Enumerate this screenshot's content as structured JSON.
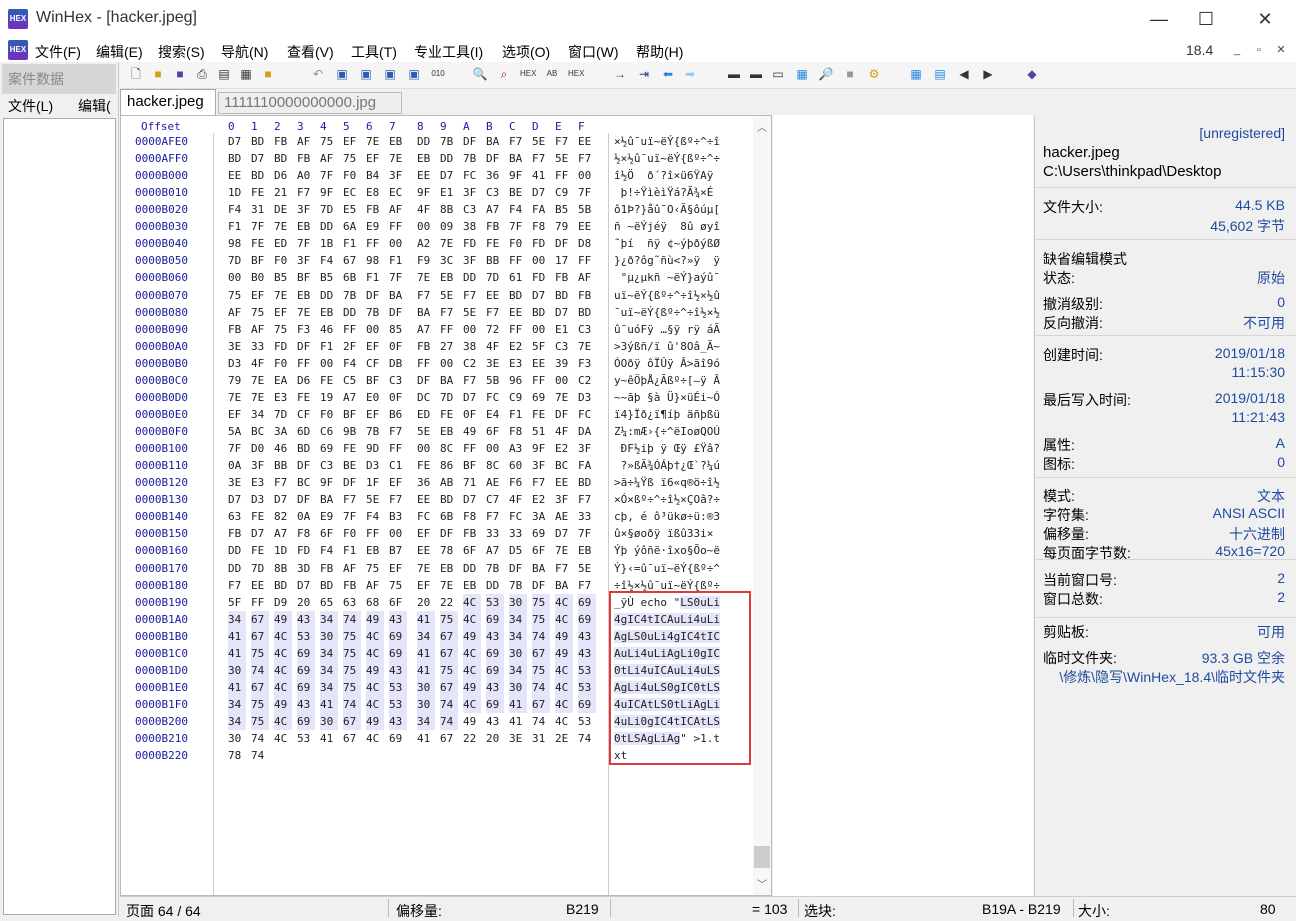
{
  "window": {
    "title": "WinHex - [hacker.jpeg]",
    "logo": "HEX",
    "controls": [
      "—",
      "☐",
      "✕"
    ]
  },
  "menu": {
    "items": [
      "文件(F)",
      "编辑(E)",
      "搜索(S)",
      "导航(N)",
      "查看(V)",
      "工具(T)",
      "专业工具(I)",
      "选项(O)",
      "窗口(W)",
      "帮助(H)"
    ],
    "version": "18.4",
    "mdi_controls": [
      "_",
      "▫",
      "✕"
    ]
  },
  "case_panel": {
    "title": "案件数据",
    "menu": [
      "文件(L)",
      "编辑("
    ]
  },
  "tabs": {
    "active": "hacker.jpeg",
    "other": "1111110000000000.jpg"
  },
  "hex_header": {
    "offset_label": "Offset",
    "columns": [
      "0",
      "1",
      "2",
      "3",
      "4",
      "5",
      "6",
      "7",
      "8",
      "9",
      "A",
      "B",
      "C",
      "D",
      "E",
      "F"
    ]
  },
  "rows": [
    {
      "off": "0000AFE0",
      "hex": [
        "D7",
        "BD",
        "FB",
        "AF",
        "75",
        "EF",
        "7E",
        "EB",
        "DD",
        "7B",
        "DF",
        "BA",
        "F7",
        "5E",
        "F7",
        "EE"
      ],
      "txt": "×½û¯uï~ëÝ{ßº÷^÷î"
    },
    {
      "off": "0000AFF0",
      "hex": [
        "BD",
        "D7",
        "BD",
        "FB",
        "AF",
        "75",
        "EF",
        "7E",
        "EB",
        "DD",
        "7B",
        "DF",
        "BA",
        "F7",
        "5E",
        "F7"
      ],
      "txt": "½×½û¯uï~ëÝ{ßº÷^÷"
    },
    {
      "off": "0000B000",
      "hex": [
        "EE",
        "BD",
        "D6",
        "A0",
        "7F",
        "F0",
        "B4",
        "3F",
        "EE",
        "D7",
        "FC",
        "36",
        "9F",
        "41",
        "FF",
        "00"
      ],
      "txt": "î½Ö  ð´?î×ü6ŸAÿ "
    },
    {
      "off": "0000B010",
      "hex": [
        "1D",
        "FE",
        "21",
        "F7",
        "9F",
        "EC",
        "E8",
        "EC",
        "9F",
        "E1",
        "3F",
        "C3",
        "BE",
        "D7",
        "C9",
        "7F"
      ],
      "txt": " þ!÷ŸìèìŸá?Ã¾×É "
    },
    {
      "off": "0000B020",
      "hex": [
        "F4",
        "31",
        "DE",
        "3F",
        "7D",
        "E5",
        "FB",
        "AF",
        "4F",
        "8B",
        "C3",
        "A7",
        "F4",
        "FA",
        "B5",
        "5B"
      ],
      "txt": "ô1Þ?}åû¯O‹Ã§ôúµ["
    },
    {
      "off": "0000B030",
      "hex": [
        "F1",
        "7F",
        "7E",
        "EB",
        "DD",
        "6A",
        "E9",
        "FF",
        "00",
        "09",
        "38",
        "FB",
        "7F",
        "F8",
        "79",
        "EE"
      ],
      "txt": "ñ ~ëÝjéÿ  8û øyî"
    },
    {
      "off": "0000B040",
      "hex": [
        "98",
        "FE",
        "ED",
        "7F",
        "1B",
        "F1",
        "FF",
        "00",
        "A2",
        "7E",
        "FD",
        "FE",
        "F0",
        "FD",
        "DF",
        "D8"
      ],
      "txt": "˜þí  ñÿ ¢~ýþðýßØ"
    },
    {
      "off": "0000B050",
      "hex": [
        "7D",
        "BF",
        "F0",
        "3F",
        "F4",
        "67",
        "98",
        "F1",
        "F9",
        "3C",
        "3F",
        "BB",
        "FF",
        "00",
        "17",
        "FF"
      ],
      "txt": "}¿ð?ôg˜ñù<?»ÿ  ÿ"
    },
    {
      "off": "0000B060",
      "hex": [
        "00",
        "B0",
        "B5",
        "BF",
        "B5",
        "6B",
        "F1",
        "7F",
        "7E",
        "EB",
        "DD",
        "7D",
        "61",
        "FD",
        "FB",
        "AF"
      ],
      "txt": " °µ¿µkñ ~ëÝ}aýû¯"
    },
    {
      "off": "0000B070",
      "hex": [
        "75",
        "EF",
        "7E",
        "EB",
        "DD",
        "7B",
        "DF",
        "BA",
        "F7",
        "5E",
        "F7",
        "EE",
        "BD",
        "D7",
        "BD",
        "FB"
      ],
      "txt": "uï~ëÝ{ßº÷^÷î½×½û"
    },
    {
      "off": "0000B080",
      "hex": [
        "AF",
        "75",
        "EF",
        "7E",
        "EB",
        "DD",
        "7B",
        "DF",
        "BA",
        "F7",
        "5E",
        "F7",
        "EE",
        "BD",
        "D7",
        "BD"
      ],
      "txt": "¯uï~ëÝ{ßº÷^÷î½×½"
    },
    {
      "off": "0000B090",
      "hex": [
        "FB",
        "AF",
        "75",
        "F3",
        "46",
        "FF",
        "00",
        "85",
        "A7",
        "FF",
        "00",
        "72",
        "FF",
        "00",
        "E1",
        "C3"
      ],
      "txt": "û¯uóFÿ …§ÿ rÿ áÃ"
    },
    {
      "off": "0000B0A0",
      "hex": [
        "3E",
        "33",
        "FD",
        "DF",
        "F1",
        "2F",
        "EF",
        "0F",
        "FB",
        "27",
        "38",
        "4F",
        "E2",
        "5F",
        "C3",
        "7E"
      ],
      "txt": ">3ýßñ/ï û'8Oâ_Ã~"
    },
    {
      "off": "0000B0B0",
      "hex": [
        "D3",
        "4F",
        "F0",
        "FF",
        "00",
        "F4",
        "CF",
        "DB",
        "FF",
        "00",
        "C2",
        "3E",
        "E3",
        "EE",
        "39",
        "F3"
      ],
      "txt": "ÓOðÿ ôÏÛÿ Â>ãî9ó"
    },
    {
      "off": "0000B0C0",
      "hex": [
        "79",
        "7E",
        "EA",
        "D6",
        "FE",
        "C5",
        "BF",
        "C3",
        "DF",
        "BA",
        "F7",
        "5B",
        "96",
        "FF",
        "00",
        "C2"
      ],
      "txt": "y~êÖþÅ¿Ãßº÷[–ÿ Â"
    },
    {
      "off": "0000B0D0",
      "hex": [
        "7E",
        "7E",
        "E3",
        "FE",
        "19",
        "A7",
        "E0",
        "0F",
        "DC",
        "7D",
        "D7",
        "FC",
        "C9",
        "69",
        "7E",
        "D3"
      ],
      "txt": "~~ãþ §à Ü}×üÉi~Ó"
    },
    {
      "off": "0000B0E0",
      "hex": [
        "EF",
        "34",
        "7D",
        "CF",
        "F0",
        "BF",
        "EF",
        "B6",
        "ED",
        "FE",
        "0F",
        "E4",
        "F1",
        "FE",
        "DF",
        "FC"
      ],
      "txt": "ï4}Ïð¿ï¶íþ äñþßü"
    },
    {
      "off": "0000B0F0",
      "hex": [
        "5A",
        "BC",
        "3A",
        "6D",
        "C6",
        "9B",
        "7B",
        "F7",
        "5E",
        "EB",
        "49",
        "6F",
        "F8",
        "51",
        "4F",
        "DA"
      ],
      "txt": "Z¼:mÆ›{÷^ëIoøQOÚ"
    },
    {
      "off": "0000B100",
      "hex": [
        "7F",
        "D0",
        "46",
        "BD",
        "69",
        "FE",
        "9D",
        "FF",
        "00",
        "8C",
        "FF",
        "00",
        "A3",
        "9F",
        "E2",
        "3F"
      ],
      "txt": " ÐF½iþ ÿ Œÿ £Ÿâ?"
    },
    {
      "off": "0000B110",
      "hex": [
        "0A",
        "3F",
        "BB",
        "DF",
        "C3",
        "BE",
        "D3",
        "C1",
        "FE",
        "86",
        "BF",
        "8C",
        "60",
        "3F",
        "BC",
        "FA"
      ],
      "txt": " ?»ßÃ¾ÓÁþ†¿Œ`?¼ú"
    },
    {
      "off": "0000B120",
      "hex": [
        "3E",
        "E3",
        "F7",
        "BC",
        "9F",
        "DF",
        "1F",
        "EF",
        "36",
        "AB",
        "71",
        "AE",
        "F6",
        "F7",
        "EE",
        "BD"
      ],
      "txt": ">ã÷¼Ÿß ï6«q®ö÷î½"
    },
    {
      "off": "0000B130",
      "hex": [
        "D7",
        "D3",
        "D7",
        "DF",
        "BA",
        "F7",
        "5E",
        "F7",
        "EE",
        "BD",
        "D7",
        "C7",
        "4F",
        "E2",
        "3F",
        "F7"
      ],
      "txt": "×Ó×ßº÷^÷î½×ÇOâ?÷"
    },
    {
      "off": "0000B140",
      "hex": [
        "63",
        "FE",
        "82",
        "0A",
        "E9",
        "7F",
        "F4",
        "B3",
        "FC",
        "6B",
        "F8",
        "F7",
        "FC",
        "3A",
        "AE",
        "33"
      ],
      "txt": "cþ‚ é ô³ükø÷ü:®3"
    },
    {
      "off": "0000B150",
      "hex": [
        "FB",
        "D7",
        "A7",
        "F8",
        "6F",
        "F0",
        "FF",
        "00",
        "EF",
        "DF",
        "FB",
        "33",
        "33",
        "69",
        "D7",
        "7F"
      ],
      "txt": "û×§øoðÿ ïßû33i× "
    },
    {
      "off": "0000B160",
      "hex": [
        "DD",
        "FE",
        "1D",
        "FD",
        "F4",
        "F1",
        "EB",
        "B7",
        "EE",
        "78",
        "6F",
        "A7",
        "D5",
        "6F",
        "7E",
        "EB"
      ],
      "txt": "Ýþ ýôñë·îxo§Õo~ë"
    },
    {
      "off": "0000B170",
      "hex": [
        "DD",
        "7D",
        "8B",
        "3D",
        "FB",
        "AF",
        "75",
        "EF",
        "7E",
        "EB",
        "DD",
        "7B",
        "DF",
        "BA",
        "F7",
        "5E"
      ],
      "txt": "Ý}‹=û¯uï~ëÝ{ßº÷^"
    },
    {
      "off": "0000B180",
      "hex": [
        "F7",
        "EE",
        "BD",
        "D7",
        "BD",
        "FB",
        "AF",
        "75",
        "EF",
        "7E",
        "EB",
        "DD",
        "7B",
        "DF",
        "BA",
        "F7"
      ],
      "txt": "÷î½×½û¯uï~ëÝ{ßº÷"
    },
    {
      "off": "0000B190",
      "hex": [
        "5F",
        "FF",
        "D9",
        "20",
        "65",
        "63",
        "68",
        "6F",
        "20",
        "22",
        "4C",
        "53",
        "30",
        "75",
        "4C",
        "69"
      ],
      "txt": "_ÿÙ echo \"",
      "txt_sel": "LS0uLi"
    },
    {
      "off": "0000B1A0",
      "hex": [
        "34",
        "67",
        "49",
        "43",
        "34",
        "74",
        "49",
        "43",
        "41",
        "75",
        "4C",
        "69",
        "34",
        "75",
        "4C",
        "69"
      ],
      "txt": "",
      "txt_sel": "4gIC4tICAuLi4uLi"
    },
    {
      "off": "0000B1B0",
      "hex": [
        "41",
        "67",
        "4C",
        "53",
        "30",
        "75",
        "4C",
        "69",
        "34",
        "67",
        "49",
        "43",
        "34",
        "74",
        "49",
        "43"
      ],
      "txt": "",
      "txt_sel": "AgLS0uLi4gIC4tIC"
    },
    {
      "off": "0000B1C0",
      "hex": [
        "41",
        "75",
        "4C",
        "69",
        "34",
        "75",
        "4C",
        "69",
        "41",
        "67",
        "4C",
        "69",
        "30",
        "67",
        "49",
        "43"
      ],
      "txt": "",
      "txt_sel": "AuLi4uLiAgLi0gIC"
    },
    {
      "off": "0000B1D0",
      "hex": [
        "30",
        "74",
        "4C",
        "69",
        "34",
        "75",
        "49",
        "43",
        "41",
        "75",
        "4C",
        "69",
        "34",
        "75",
        "4C",
        "53"
      ],
      "txt": "",
      "txt_sel": "0tLi4uICAuLi4uLS"
    },
    {
      "off": "0000B1E0",
      "hex": [
        "41",
        "67",
        "4C",
        "69",
        "34",
        "75",
        "4C",
        "53",
        "30",
        "67",
        "49",
        "43",
        "30",
        "74",
        "4C",
        "53"
      ],
      "txt": "",
      "txt_sel": "AgLi4uLS0gIC0tLS"
    },
    {
      "off": "0000B1F0",
      "hex": [
        "34",
        "75",
        "49",
        "43",
        "41",
        "74",
        "4C",
        "53",
        "30",
        "74",
        "4C",
        "69",
        "41",
        "67",
        "4C",
        "69"
      ],
      "txt": "",
      "txt_sel": "4uICAtLS0tLiAgLi"
    },
    {
      "off": "0000B200",
      "hex": [
        "34",
        "75",
        "4C",
        "69",
        "30",
        "67",
        "49",
        "43",
        "34",
        "74",
        "49",
        "43",
        "41",
        "74",
        "4C",
        "53"
      ],
      "txt": "",
      "txt_sel": "4uLi0gIC4tICAtLS"
    },
    {
      "off": "0000B210",
      "hex": [
        "30",
        "74",
        "4C",
        "53",
        "41",
        "67",
        "4C",
        "69",
        "41",
        "67",
        "22",
        "20",
        "3E",
        "31",
        "2E",
        "74"
      ],
      "txt": "\" >1.t",
      "txt_sel": "0tLSAgLiAg"
    },
    {
      "off": "0000B220",
      "hex": [
        "78",
        "74"
      ],
      "txt": "xt"
    }
  ],
  "info": {
    "unregistered": "[unregistered]",
    "file_name": "hacker.jpeg",
    "file_path": "C:\\Users\\thinkpad\\Desktop",
    "file_size_label": "文件大小:",
    "file_size_kb": "44.5 KB",
    "file_size_bytes": "45,602 字节",
    "default_edit_mode": "缺省编辑模式",
    "state_label": "状态:",
    "state_value": "原始",
    "undo_label": "撤消级别:",
    "undo_value": "0",
    "redo_label": "反向撤消:",
    "redo_value": "不可用",
    "created_label": "创建时间:",
    "created_date": "2019/01/18",
    "created_time": "11:15:30",
    "modified_label": "最后写入时间:",
    "modified_date": "2019/01/18",
    "modified_time": "11:21:43",
    "attr_label": "属性:",
    "attr_value": "A",
    "icon_label": "图标:",
    "icon_value": "0",
    "mode_label": "模式:",
    "mode_value": "文本",
    "charset_label": "字符集:",
    "charset_value": "ANSI ASCII",
    "offsets_label": "偏移量:",
    "offsets_value": "十六进制",
    "bpp_label": "每页面字节数:",
    "bpp_value": "45x16=720",
    "cur_win_label": "当前窗口号:",
    "cur_win_value": "2",
    "total_win_label": "窗口总数:",
    "total_win_value": "2",
    "clipboard_label": "剪贴板:",
    "clipboard_value": "可用",
    "temp_label": "临时文件夹:",
    "temp_value": "93.3 GB 空余",
    "temp_path": "\\修炼\\隐写\\WinHex_18.4\\临时文件夹"
  },
  "status": {
    "page": "页面 64 / 64",
    "offset_label": "偏移量:",
    "offset_value": "B219",
    "eq": "= 103",
    "block_label": "选块:",
    "block_value": "B19A - B219",
    "size_label": "大小:",
    "size_value": "80"
  },
  "colors": {
    "accent": "#1e4b9e",
    "offset_text": "#1a1aa0",
    "selection": "#e4e4fa",
    "annotation_box": "#e0393e"
  }
}
